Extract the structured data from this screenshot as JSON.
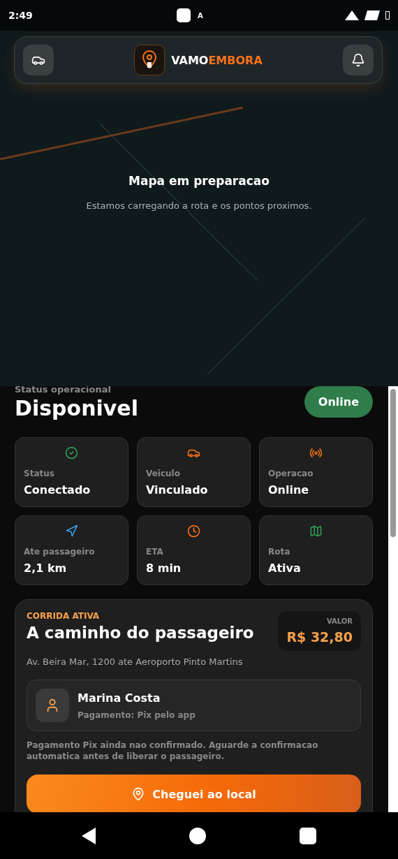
{
  "status_bar": {
    "time": "2:49",
    "notification": "A"
  },
  "header": {
    "brand_first": "VAMO",
    "brand_second": "EMBORA"
  },
  "map": {
    "title": "Mapa em preparacao",
    "subtitle": "Estamos carregando a rota e os pontos proximos."
  },
  "status": {
    "label": "Status operacional",
    "value": "Disponivel",
    "badge": "Online"
  },
  "tiles": [
    {
      "kind": "check",
      "label": "Status",
      "value": "Conectado",
      "color": "#2e9e55"
    },
    {
      "kind": "car",
      "label": "Veiculo",
      "value": "Vinculado",
      "color": "#f97316"
    },
    {
      "kind": "signal",
      "label": "Operacao",
      "value": "Online",
      "color": "#f97316"
    },
    {
      "kind": "navigation",
      "label": "Ate passageiro",
      "value": "2,1 km",
      "color": "#3b9be8"
    },
    {
      "kind": "clock",
      "label": "ETA",
      "value": "8 min",
      "color": "#f97316"
    },
    {
      "kind": "map",
      "label": "Rota",
      "value": "Ativa",
      "color": "#2e9e55"
    }
  ],
  "ride": {
    "eyebrow": "CORRIDA ATIVA",
    "title": "A caminho do passageiro",
    "route": "Av. Beira Mar, 1200 ate Aeroporto Pinto Martins",
    "price_label": "VALOR",
    "price": "R$ 32,80",
    "passenger": {
      "name": "Marina Costa",
      "payment": "Pagamento: Pix pelo app"
    },
    "notice": "Pagamento Pix ainda nao confirmado. Aguarde a confirmacao automatica antes de liberar o passageiro.",
    "action": "Cheguei ao local"
  }
}
